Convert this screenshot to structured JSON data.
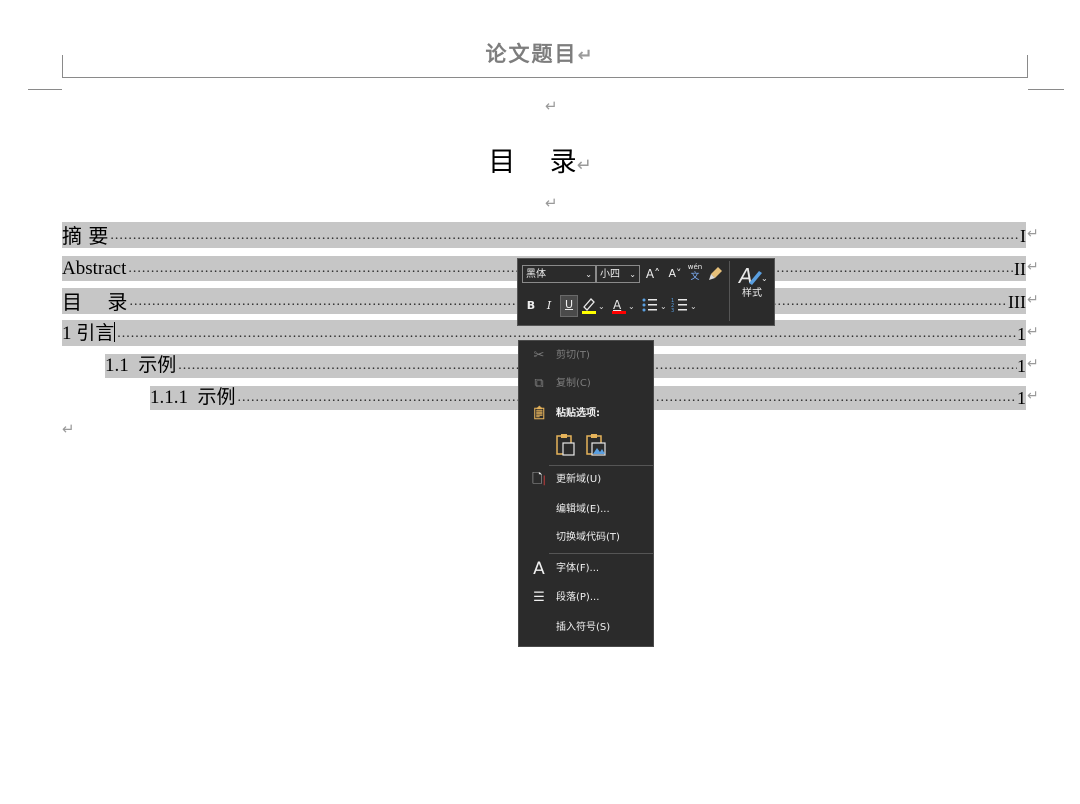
{
  "header": {
    "title": "论文题目"
  },
  "marks": {
    "return": "↵"
  },
  "toc_heading": "目    录",
  "toc": [
    {
      "text": "摘 要",
      "dots": "....................................................................................................................................................................................................................................................................",
      "page": "I"
    },
    {
      "text": "Abstract",
      "dots": "....................................................................................................................................................................................................................................................................",
      "page": "II"
    },
    {
      "text": "目    录",
      "dots": "....................................................................................................................................................................................................................................................................",
      "page": "III"
    },
    {
      "text": "1 引言",
      "dots": "....................................................................................................................................................................................................................................................................",
      "page": "1"
    },
    {
      "text": "1.1  示例",
      "dots": "....................................................................................................................................................................................................................................................................",
      "page": "1"
    },
    {
      "text": "1.1.1  示例",
      "dots": "....................................................................................................................................................................................................................................................................",
      "page": "1"
    }
  ],
  "mini_toolbar": {
    "font_name": "黑体",
    "font_size": "小四",
    "grow_font": "A˄",
    "shrink_font": "A˅",
    "phonetic": "wén",
    "bold": "B",
    "italic": "I",
    "underline": "U",
    "font_color": "A",
    "styles_label": "样式",
    "highlight_color": "#ffff00",
    "font_color_value": "#ff0000"
  },
  "context_menu": {
    "cut": "剪切(T)",
    "copy": "复制(C)",
    "paste_options": "粘贴选项:",
    "update_field": "更新域(U)",
    "edit_field": "编辑域(E)...",
    "toggle_field_codes": "切换域代码(T)",
    "font": "字体(F)...",
    "paragraph": "段落(P)...",
    "insert_symbol": "插入符号(S)"
  }
}
